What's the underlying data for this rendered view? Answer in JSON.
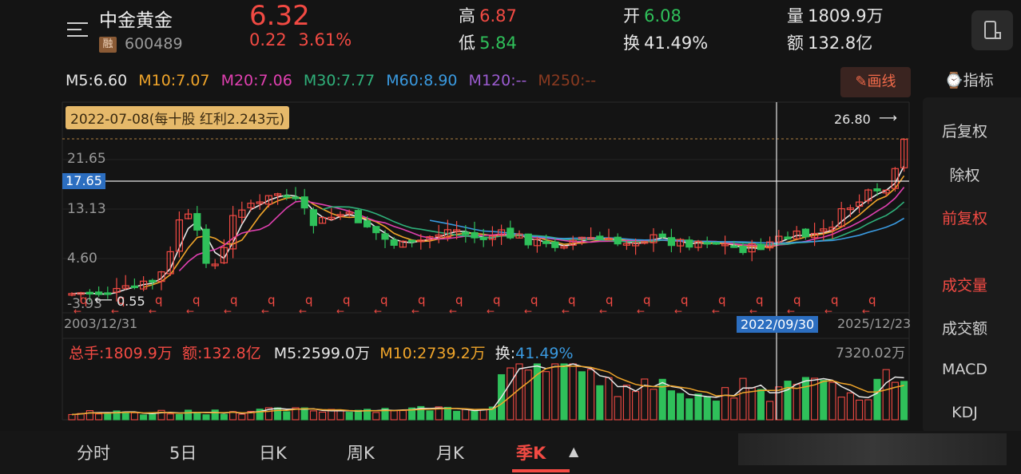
{
  "header": {
    "stock_name": "中金黄金",
    "badge": "融",
    "code": "600489",
    "price": "6.32",
    "change": "0.22  3.61%",
    "high_label": "高",
    "high_value": "6.87",
    "low_label": "低",
    "low_value": "5.84",
    "open_label": "开",
    "open_value": "6.08",
    "turnover_label": "换",
    "turnover_value": "41.49%",
    "volume_label": "量",
    "volume_value": "1809.9万",
    "amount_label": "额",
    "amount_value": "132.8亿"
  },
  "ma": [
    {
      "text": "M5:6.60",
      "color": "#e8e8e8"
    },
    {
      "text": "M10:7.07",
      "color": "#f0a52a"
    },
    {
      "text": "M20:7.06",
      "color": "#e040b0"
    },
    {
      "text": "M30:7.77",
      "color": "#2fb07a"
    },
    {
      "text": "M60:8.90",
      "color": "#3a9ae0"
    },
    {
      "text": "M120:--",
      "color": "#9b5bd0"
    },
    {
      "text": "M250:--",
      "color": "#8a3a20"
    }
  ],
  "draw_button": "✎画线",
  "indicator_header": "⌚指标",
  "right_panel": {
    "items": [
      "后复权",
      "除权",
      "前复权",
      "成交量",
      "成交额",
      "MACD",
      "KDJ"
    ],
    "active": [
      "前复权",
      "成交量"
    ]
  },
  "chart": {
    "dividend_tag": "2022-07-08(每十股 红利2.243元)",
    "crosshair_price": "17.65",
    "max_marker": "26.80",
    "min_marker": "0.55",
    "y_labels": [
      "21.65",
      "13.13",
      "4.60",
      "-3.93"
    ],
    "date_start": "2003/12/31",
    "date_cross": "2022/09/30",
    "date_end": "2025/12/23",
    "q_marker": "q"
  },
  "volume": {
    "total": "总手:1809.9万",
    "amount": "额:132.8亿",
    "m5": "M5:2599.0万",
    "m10": "M10:2739.2万",
    "turnover_label": "换:",
    "turnover_value": "41.49%",
    "max": "7320.02万"
  },
  "tabs": [
    "分时",
    "5日",
    "日K",
    "周K",
    "月K",
    "季K"
  ],
  "active_tab": "季K",
  "colors": {
    "up": "#f24a43",
    "down": "#2fc05a",
    "accent": "#2c6ec0",
    "background": "#141414"
  }
}
